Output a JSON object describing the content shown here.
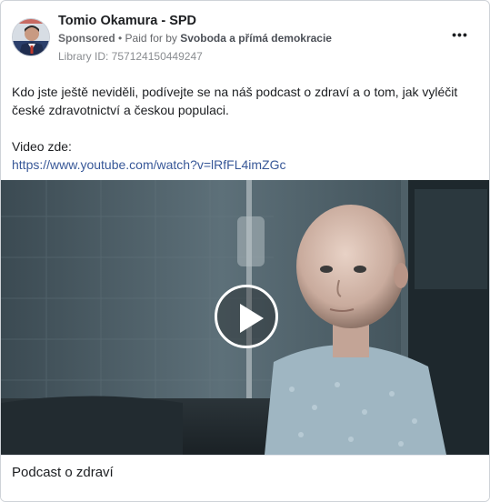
{
  "post": {
    "page_name": "Tomio Okamura - SPD",
    "sponsored_label": "Sponsored",
    "paid_for_prefix": " • Paid for by ",
    "payer": "Svoboda a přímá demokracie",
    "library_id": "Library ID: 757124150449247",
    "more_icon": "•••",
    "text_line_1": "Kdo jste ještě neviděli, podívejte se na náš podcast o zdraví a o tom, jak vyléčit",
    "text_line_2": "české zdravotnictví a českou populaci.",
    "text_line_3": "Video zde:",
    "link": "https://www.youtube.com/watch?v=lRfFL4imZGc"
  },
  "media": {
    "type": "video",
    "play_icon": "play-icon"
  },
  "footer": {
    "title": "Podcast o zdraví"
  }
}
